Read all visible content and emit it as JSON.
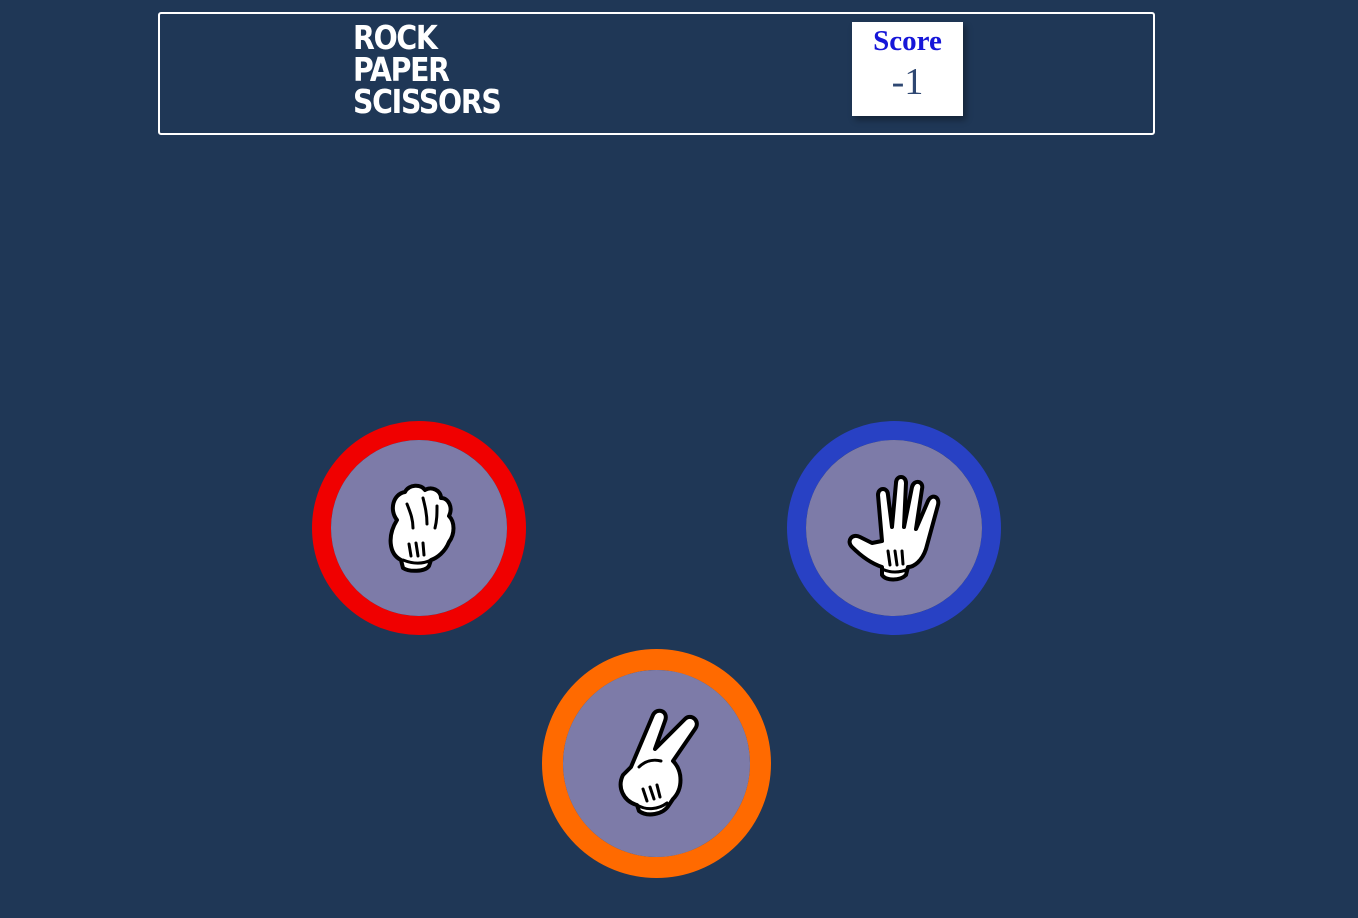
{
  "header": {
    "title_lines": [
      "ROCK",
      "PAPER",
      "SCISSORS"
    ],
    "score": {
      "label": "Score",
      "value": "-1"
    }
  },
  "choices": [
    {
      "id": "rock",
      "icon": "rock-fist-icon",
      "ring_color": "#f00000"
    },
    {
      "id": "paper",
      "icon": "paper-hand-icon",
      "ring_color": "#2841c4"
    },
    {
      "id": "scissors",
      "icon": "scissors-hand-icon",
      "ring_color": "#ff6a00"
    }
  ],
  "colors": {
    "background": "#1f3756",
    "circle_fill": "#7d7ba8",
    "score_label": "#1616d8",
    "score_value": "#2e4772"
  }
}
